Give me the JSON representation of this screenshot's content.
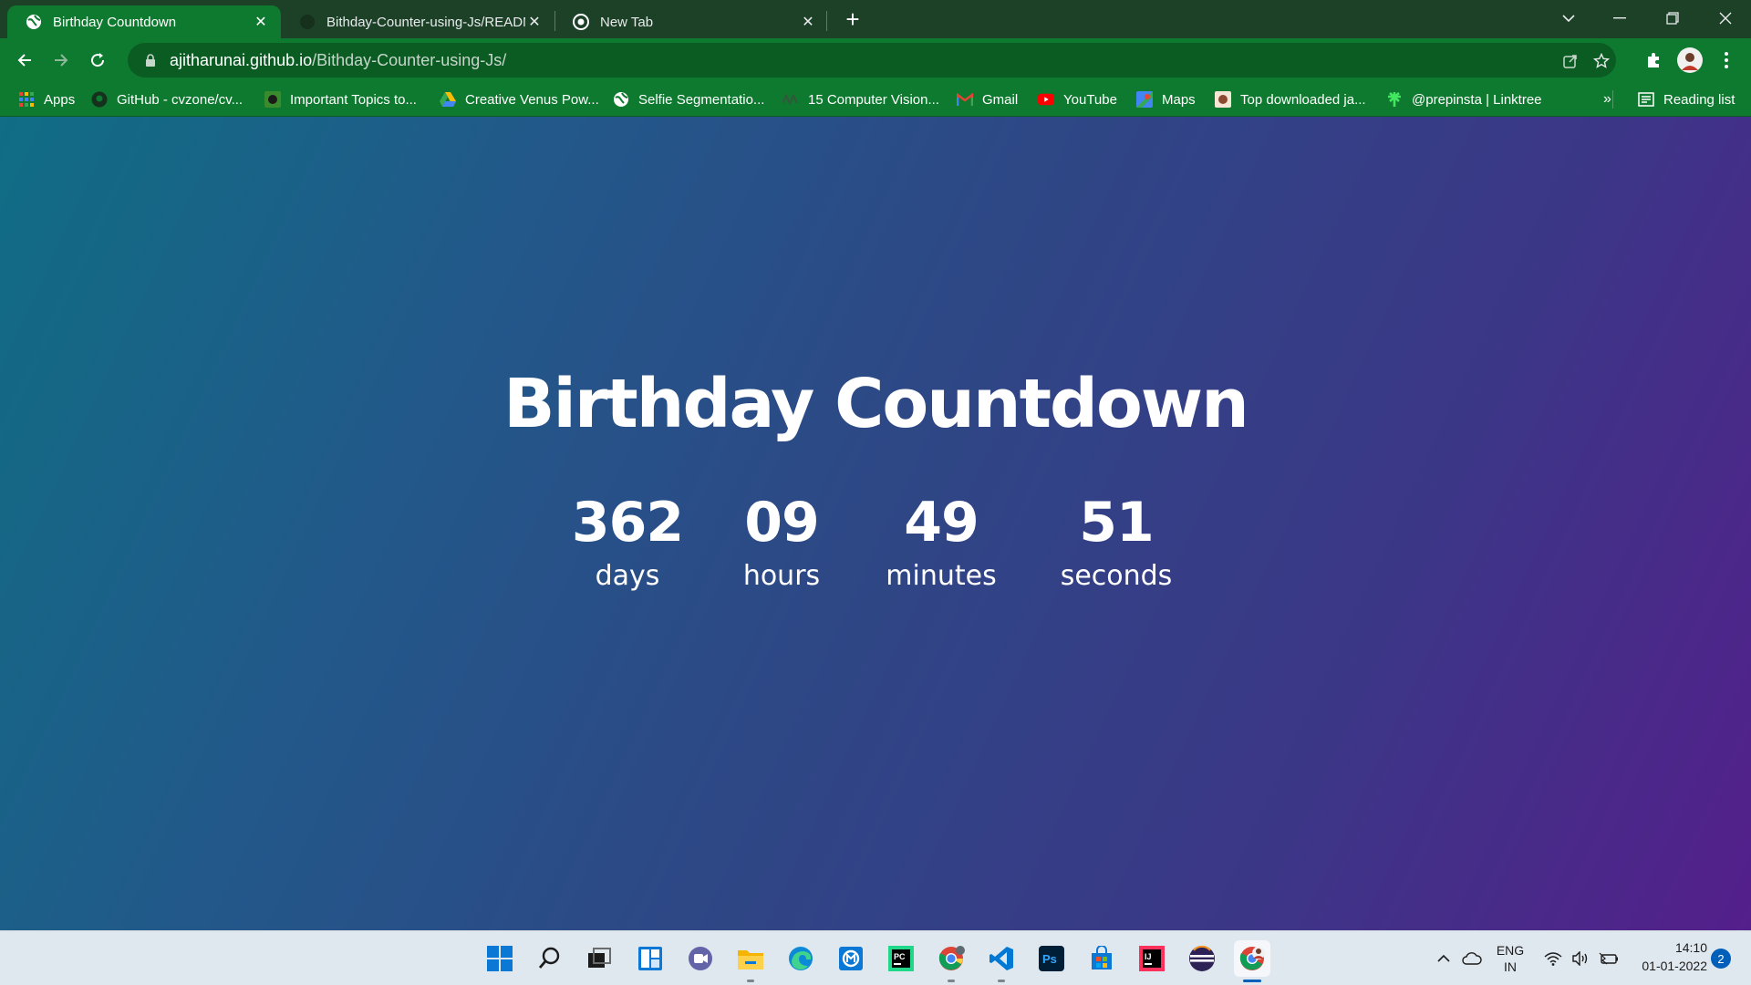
{
  "browser": {
    "tabs": [
      {
        "title": "Birthday Countdown",
        "favicon": "globe-icon",
        "active": true
      },
      {
        "title": "Bithday-Counter-using-Js/README.md",
        "favicon": "github-icon",
        "active": false
      },
      {
        "title": "New Tab",
        "favicon": "chrome-icon",
        "active": false
      }
    ],
    "url_host": "ajitharunai.github.io",
    "url_path": "/Bithday-Counter-using-Js/",
    "bookmarks": [
      {
        "label": "Apps",
        "icon": "apps-grid-icon"
      },
      {
        "label": "GitHub - cvzone/cv...",
        "icon": "github-icon"
      },
      {
        "label": "Important Topics to...",
        "icon": "page-icon"
      },
      {
        "label": "Creative Venus Pow...",
        "icon": "drive-icon"
      },
      {
        "label": "Selfie Segmentatio...",
        "icon": "globe-icon"
      },
      {
        "label": "15 Computer Vision...",
        "icon": "site-icon"
      },
      {
        "label": "Gmail",
        "icon": "gmail-icon"
      },
      {
        "label": "YouTube",
        "icon": "youtube-icon"
      },
      {
        "label": "Maps",
        "icon": "maps-icon"
      },
      {
        "label": "Top downloaded ja...",
        "icon": "site-icon"
      },
      {
        "label": "@prepinsta | Linktree",
        "icon": "linktree-icon"
      }
    ],
    "bookmarks_overflow": "»",
    "reading_list": "Reading list"
  },
  "page": {
    "title": "Birthday Countdown",
    "countdown": [
      {
        "value": "362",
        "label": "days"
      },
      {
        "value": "09",
        "label": "hours"
      },
      {
        "value": "49",
        "label": "minutes"
      },
      {
        "value": "51",
        "label": "seconds"
      }
    ]
  },
  "taskbar": {
    "apps": [
      "windows-start-icon",
      "search-icon",
      "task-view-icon",
      "widgets-icon",
      "teams-chat-icon",
      "file-explorer-icon",
      "edge-icon",
      "photos-icon",
      "pycharm-icon",
      "chrome-icon",
      "vscode-icon",
      "photoshop-icon",
      "store-icon",
      "intellij-icon",
      "eclipse-icon",
      "chrome-profile-icon"
    ],
    "language": "ENG",
    "region": "IN",
    "time": "14:10",
    "date": "01-01-2022",
    "notifications": "2"
  },
  "colors": {
    "chrome_frame": "#1c4127",
    "chrome_toolbar": "#0e7a2f",
    "gradient_start": "#106d85",
    "gradient_end": "#541f8b",
    "taskbar": "#dfe7ef"
  }
}
